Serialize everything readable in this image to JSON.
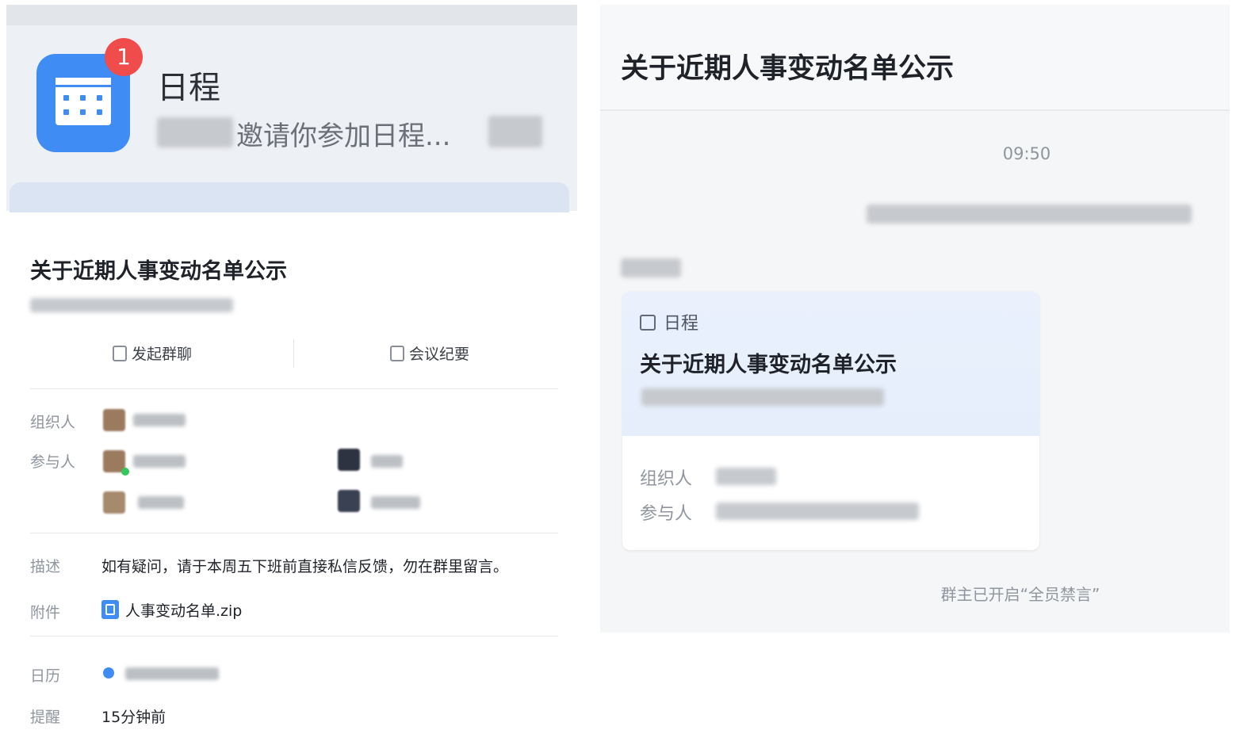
{
  "notification": {
    "badge_count": "1",
    "title": "日程",
    "message": "邀请你参加日程..."
  },
  "event_detail": {
    "title": "关于近期人事变动名单公示",
    "actions": {
      "start_group_chat": "发起群聊",
      "meeting_notes": "会议纪要"
    },
    "labels": {
      "organizer": "组织人",
      "participants": "参与人",
      "description": "描述",
      "attachment": "附件",
      "calendar": "日历",
      "reminder": "提醒"
    },
    "description": "如有疑问，请于本周五下班前直接私信反馈，勿在群里留言。",
    "attachment_name": "人事变动名单.zip",
    "reminder": "15分钟前"
  },
  "chat": {
    "title": "关于近期人事变动名单公示",
    "time": "09:50",
    "card": {
      "tag": "日程",
      "title": "关于近期人事变动名单公示",
      "organizer_label": "组织人",
      "participants_label": "参与人"
    },
    "footer_notice": "群主已开启“全员禁言”"
  },
  "colors": {
    "accent": "#3e8cf4",
    "badge": "#f14c4c"
  }
}
